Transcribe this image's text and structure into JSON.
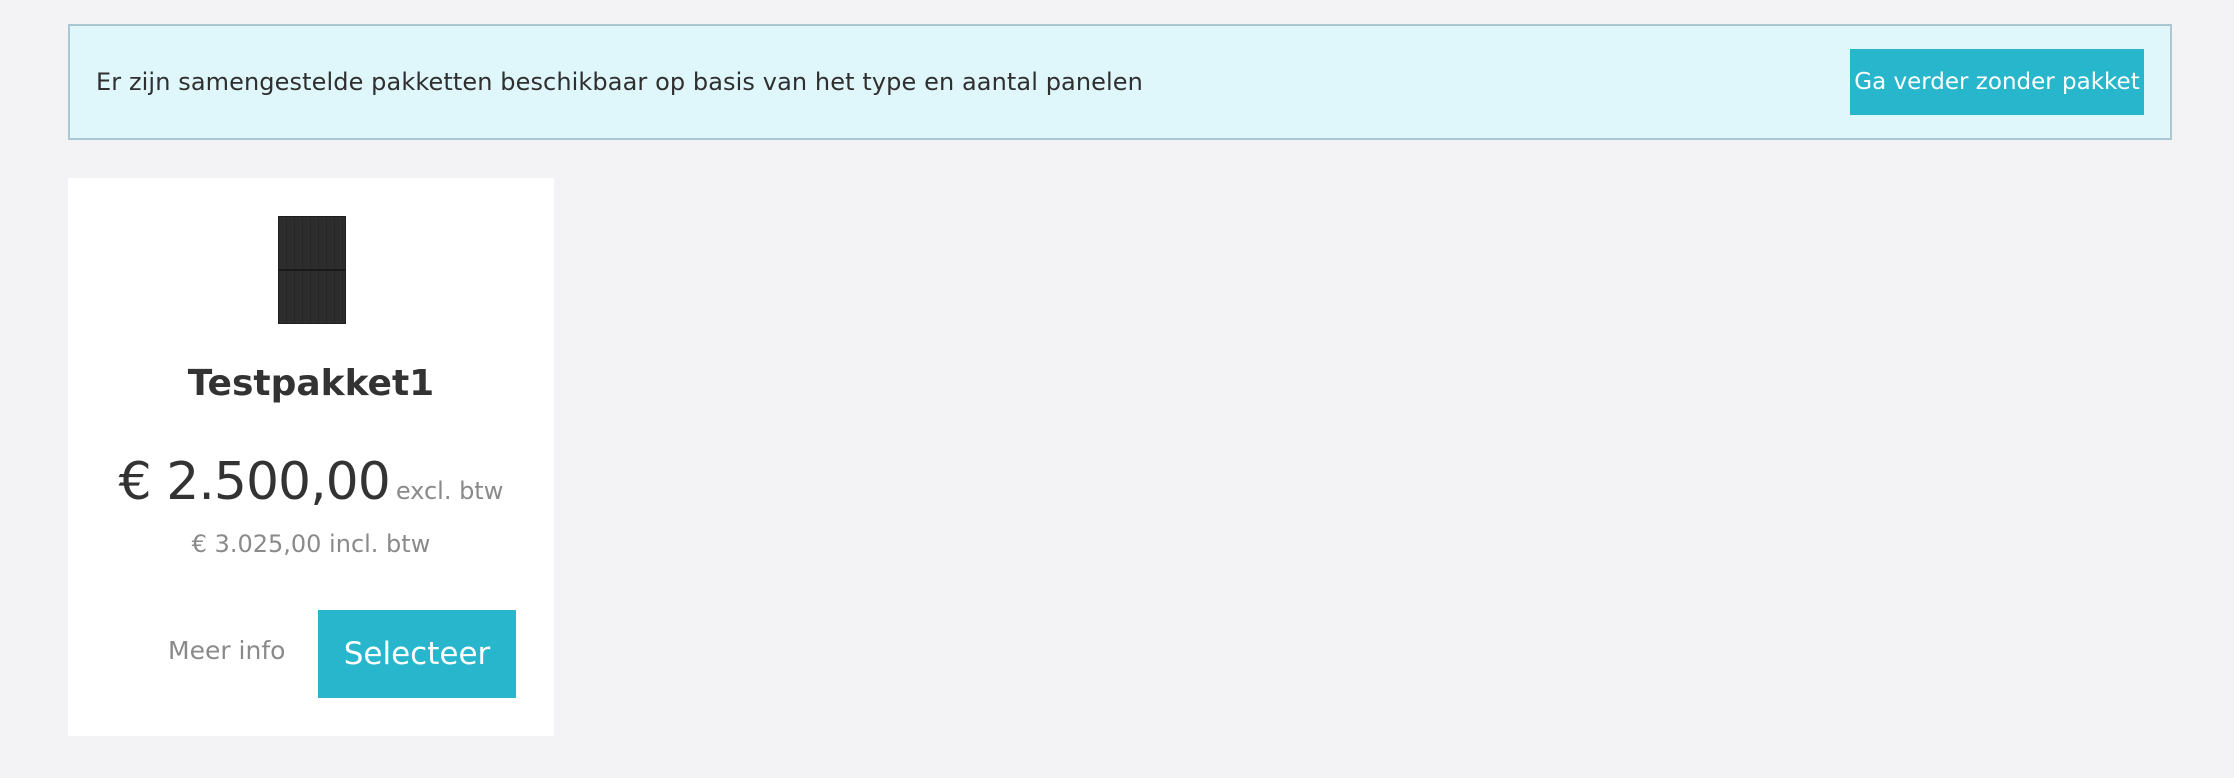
{
  "banner": {
    "message": "Er zijn samengestelde pakketten beschikbaar op basis van het type en aantal panelen",
    "continue_label": "Ga verder zonder pakket"
  },
  "package": {
    "image_icon": "solar-panel-icon",
    "title": "Testpakket1",
    "price_excl": "€ 2.500,00",
    "price_excl_label": "excl. btw",
    "price_incl": "€ 3.025,00 incl. btw",
    "more_info_label": "Meer info",
    "select_label": "Selecteer"
  },
  "colors": {
    "accent": "#27b6cc",
    "banner_bg": "#dff6fa",
    "page_bg": "#f3f3f5"
  }
}
